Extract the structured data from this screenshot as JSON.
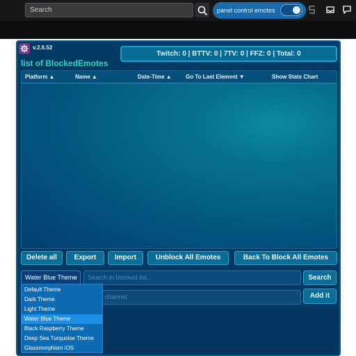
{
  "topbar": {
    "search_placeholder": "Search",
    "toggle_label": "panel control emotes",
    "toggle_on": true
  },
  "panel": {
    "version": "v.2.6.52",
    "title": "list of BlockedEmotes",
    "counter": "Twitch: 0 | BTTV: 0 | 7TV: 0 | FFZ: 0 | Total: 0",
    "columns": [
      "Platform ▲",
      "Name ▲",
      "Date-Time ▲",
      "Go To Last Element ▼",
      "Show Stats Chart"
    ],
    "buttons": {
      "delete_all": "Delete all",
      "export": "Export",
      "import": "Import",
      "unblock_all": "Unblock All Emotes",
      "back_to_block": "Back To Block All Emotes"
    },
    "theme_select": {
      "value": "Water Blue Theme"
    },
    "blocked_search": {
      "placeholder": "Search in blocked list..."
    },
    "search_button": "Search",
    "channel_input": {
      "placeholder": "o add channel"
    },
    "add_button": "Add it"
  },
  "dropdown": {
    "options": [
      "Default Theme",
      "Dark Theme",
      "Light Theme",
      "Water Blue Theme",
      "Black Raspberry Theme",
      "Deep Sea Turquoise Theme",
      "Glassmorphism iOS"
    ],
    "selected": "Water Blue Theme"
  },
  "colors": {
    "accent": "#1c6aa8",
    "panel_bg": "#033a63",
    "title": "#2dd4c8",
    "button_bg": "#0c6e98"
  }
}
